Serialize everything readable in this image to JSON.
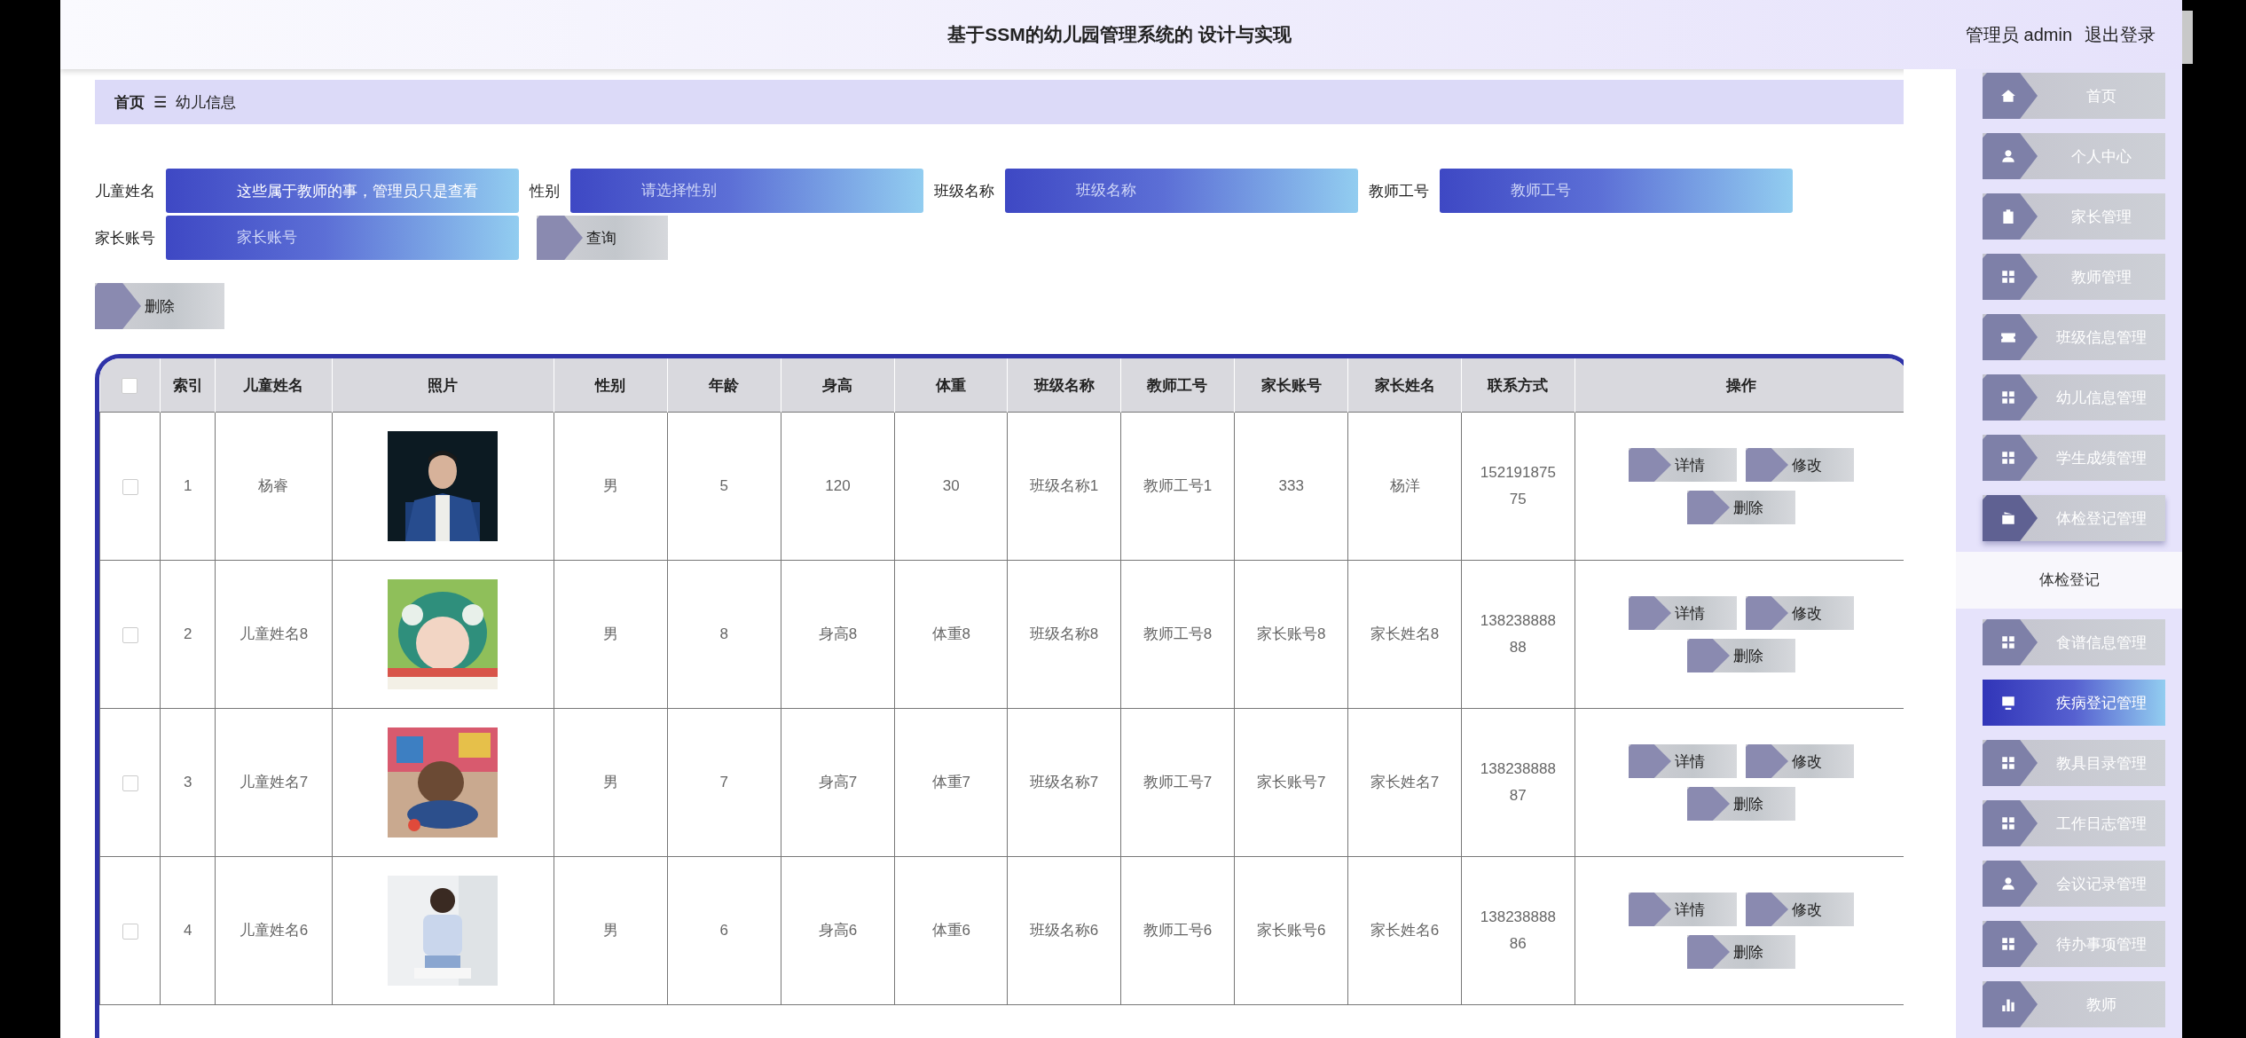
{
  "header": {
    "title": "基于SSM的幼儿园管理系统的 设计与实现",
    "user": "管理员 admin",
    "logout": "退出登录"
  },
  "breadcrumb": {
    "home": "首页",
    "separator": "☰",
    "current": "幼儿信息"
  },
  "filters": [
    {
      "label": "儿童姓名",
      "value": "这些属于教师的事，管理员只是查看"
    },
    {
      "label": "性别",
      "placeholder": "请选择性别"
    },
    {
      "label": "班级名称",
      "placeholder": "班级名称"
    },
    {
      "label": "教师工号",
      "placeholder": "教师工号"
    },
    {
      "label": "家长账号",
      "placeholder": "家长账号"
    }
  ],
  "search_button": "查询",
  "delete_button": "删除",
  "table": {
    "select_all_checked": false,
    "columns": [
      "索引",
      "儿童姓名",
      "照片",
      "性别",
      "年龄",
      "身高",
      "体重",
      "班级名称",
      "教师工号",
      "家长账号",
      "家长姓名",
      "联系方式",
      "操作"
    ],
    "rows": [
      {
        "checked": false,
        "cells": [
          "1",
          "杨睿",
          null,
          "男",
          "5",
          "120",
          "30",
          "班级名称1",
          "教师工号1",
          "333",
          "杨洋",
          "15219187575"
        ],
        "photo": {
          "kind": "picture"
        },
        "actions": [
          "详情",
          "修改",
          "删除"
        ]
      },
      {
        "checked": false,
        "cells": [
          "2",
          "儿童姓名8",
          null,
          "男",
          "8",
          "身高8",
          "体重8",
          "班级名称8",
          "教师工号8",
          "家长账号8",
          "家长姓名8",
          "13823888888"
        ],
        "photo": {
          "kind": "picture"
        },
        "actions": [
          "详情",
          "修改",
          "删除"
        ]
      },
      {
        "checked": false,
        "cells": [
          "3",
          "儿童姓名7",
          null,
          "男",
          "7",
          "身高7",
          "体重7",
          "班级名称7",
          "教师工号7",
          "家长账号7",
          "家长姓名7",
          "13823888887"
        ],
        "photo": {
          "kind": "picture"
        },
        "actions": [
          "详情",
          "修改",
          "删除"
        ]
      },
      {
        "checked": false,
        "cells": [
          "4",
          "儿童姓名6",
          null,
          "男",
          "6",
          "身高6",
          "体重6",
          "班级名称6",
          "教师工号6",
          "家长账号6",
          "家长姓名6",
          "13823888886"
        ],
        "photo": {
          "kind": "picture"
        },
        "actions": [
          "详情",
          "修改",
          "删除"
        ]
      }
    ]
  },
  "sidebar": {
    "items": [
      {
        "label": "首页",
        "selected": false
      },
      {
        "label": "个人中心",
        "selected": false
      },
      {
        "label": "家长管理",
        "selected": false
      },
      {
        "label": "教师管理",
        "selected": false
      },
      {
        "label": "班级信息管理",
        "selected": false
      },
      {
        "label": "幼儿信息管理",
        "selected": false
      },
      {
        "label": "学生成绩管理",
        "selected": false
      },
      {
        "label": "体检登记管理",
        "selected": false,
        "expanded": true,
        "children": [
          {
            "label": "体检登记",
            "selected": false
          }
        ]
      },
      {
        "label": "食谱信息管理",
        "selected": false
      },
      {
        "label": "疾病登记管理",
        "selected": true
      },
      {
        "label": "教具目录管理",
        "selected": false
      },
      {
        "label": "工作日志管理",
        "selected": false
      },
      {
        "label": "会议记录管理",
        "selected": false
      },
      {
        "label": "待办事项管理",
        "selected": false
      },
      {
        "label": "教师",
        "selected": false
      }
    ]
  }
}
